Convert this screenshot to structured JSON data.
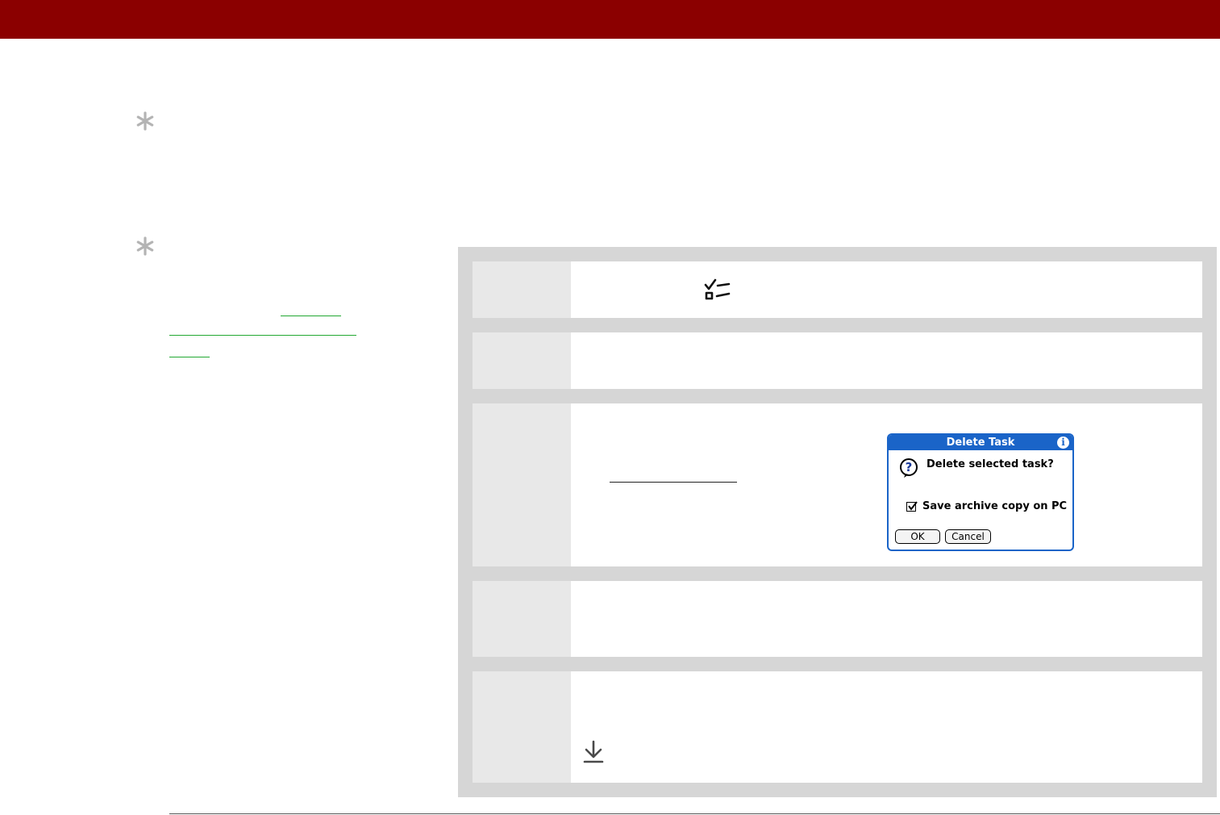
{
  "colors": {
    "header": "#8b0000",
    "panel": "#d6d6d6",
    "step_label": "#e8e8e8",
    "link": "#22a832",
    "dialog_accent": "#1a64c8"
  },
  "icons": {
    "tip_1": "asterisk-tip-icon",
    "tip_2": "asterisk-tip-icon",
    "step_1": "tasks-checklist-icon",
    "step_5": "done-down-arrow-icon",
    "dialog": "question-mark-icon"
  },
  "dialog": {
    "title": "Delete Task",
    "info_glyph": "i",
    "message": "Delete selected task?",
    "checkbox_label": "Save archive copy on PC",
    "checkbox_checked": true,
    "ok_label": "OK",
    "cancel_label": "Cancel"
  }
}
